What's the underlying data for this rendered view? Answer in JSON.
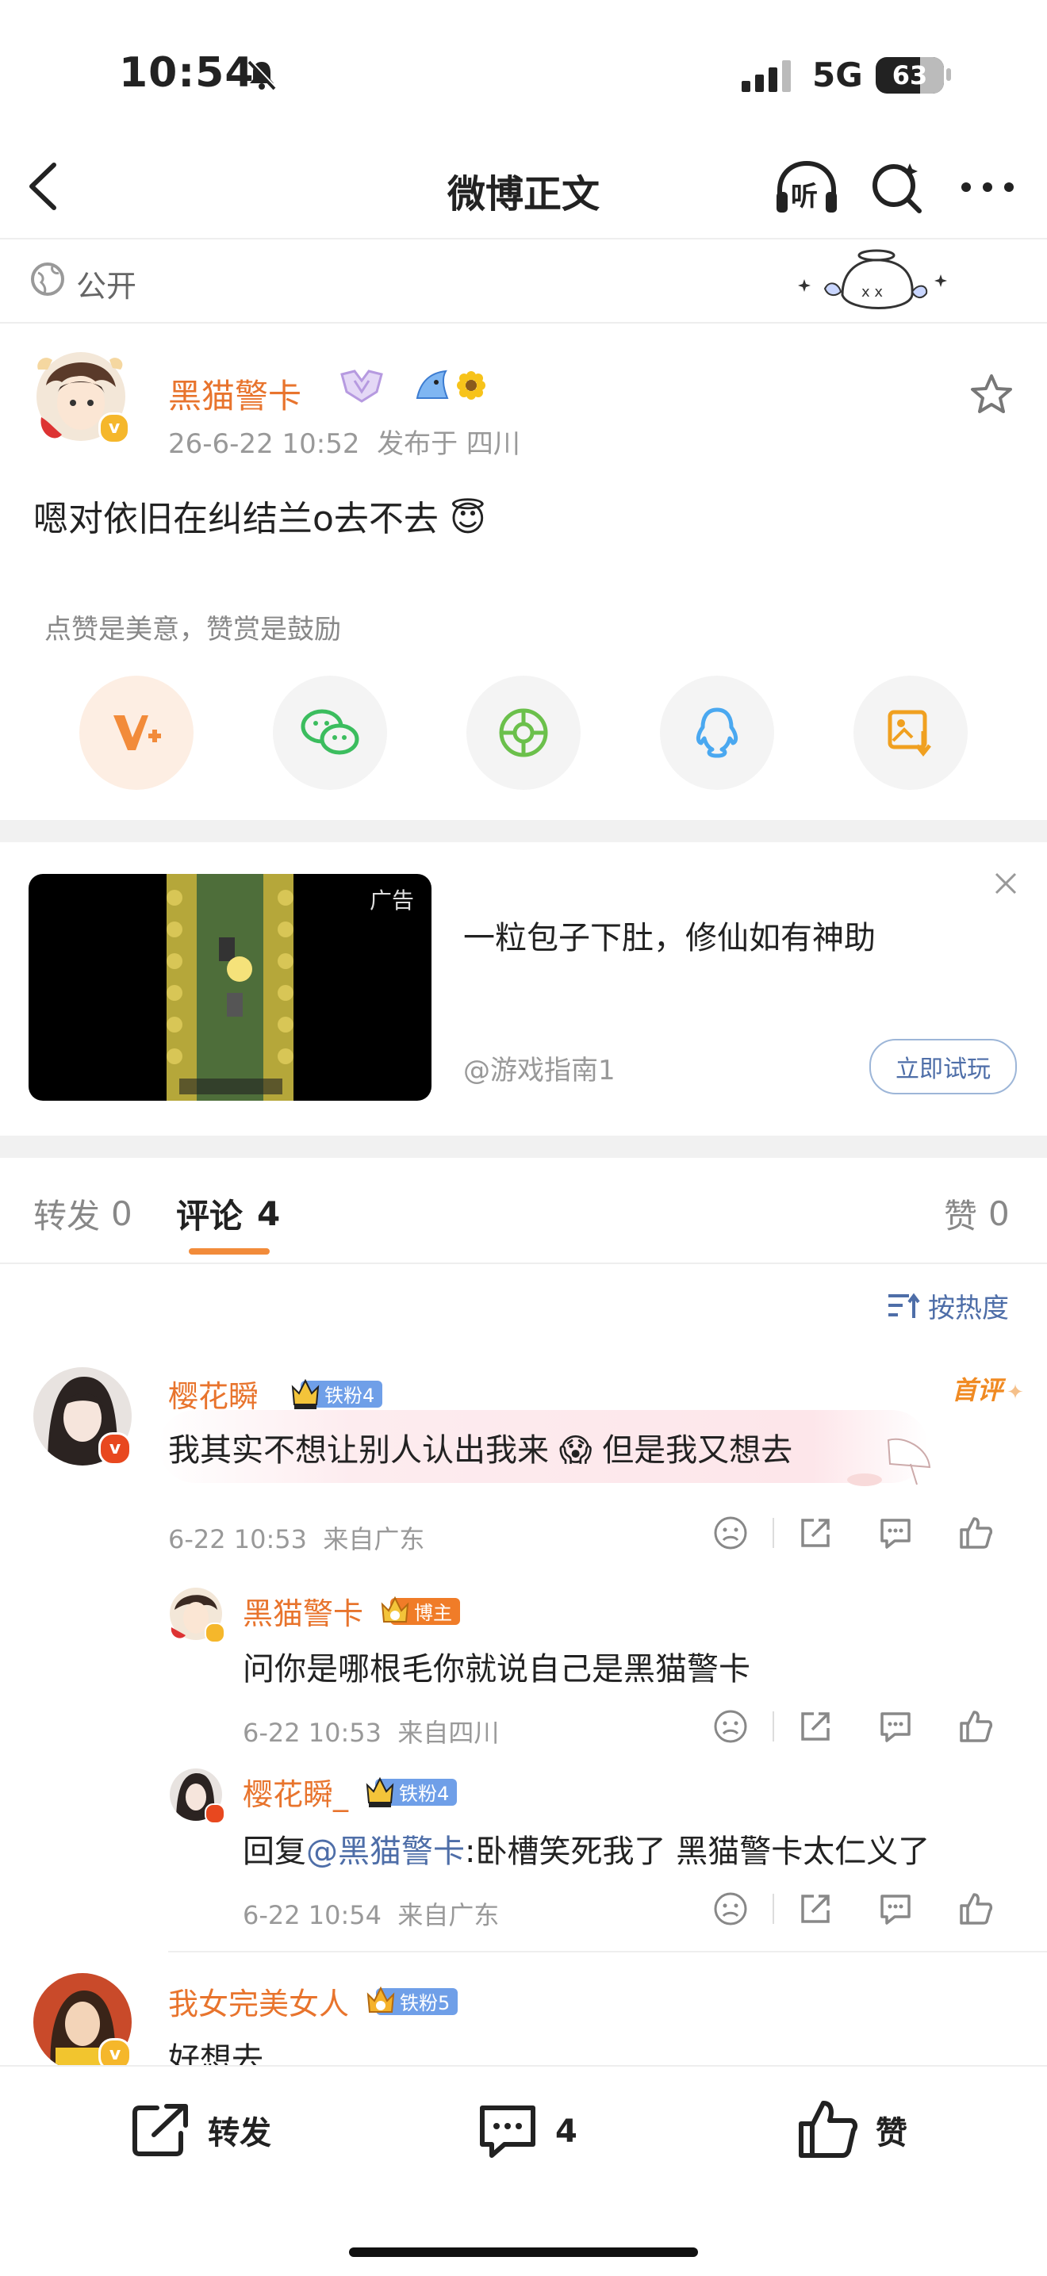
{
  "status_bar": {
    "time": "10:54",
    "network": "5G",
    "battery": "63"
  },
  "nav": {
    "title": "微博正文",
    "listen_label": "听"
  },
  "visibility": {
    "label": "公开"
  },
  "post": {
    "author": "黑猫警卡",
    "meta": "26-6-22 10:52  发布于 四川",
    "text": "嗯对依旧在纠结兰o去不去 😇",
    "tip_text": "点赞是美意，赞赏是鼓励"
  },
  "ad": {
    "tag": "广告",
    "title": "一粒包子下肚，修仙如有神助",
    "source": "@游戏指南1",
    "cta": "立即试玩"
  },
  "tabs": {
    "repost_label": "转发",
    "repost_count": "0",
    "comment_label": "评论",
    "comment_count": "4",
    "like_label": "赞",
    "like_count": "0"
  },
  "sort": {
    "label": "按热度"
  },
  "comments": [
    {
      "user": "樱花瞬_",
      "badge": "铁粉4",
      "first_tag": "首评",
      "text": "我其实不想让别人认出我来 😱 但是我又想去",
      "meta": "6-22 10:53  来自广东"
    }
  ],
  "replies": [
    {
      "user": "黑猫警卡",
      "badge": "博主",
      "text": "问你是哪根毛你就说自己是黑猫警卡",
      "meta": "6-22 10:53  来自四川"
    },
    {
      "user": "樱花瞬_",
      "badge": "铁粉4",
      "reply_prefix": "回复",
      "mention": "@黑猫警卡",
      "text": ":卧槽笑死我了 黑猫警卡太仁义了",
      "meta": "6-22 10:54  来自广东"
    }
  ],
  "comment2": {
    "user": "我女完美女人",
    "badge": "铁粉5",
    "text": "好想去"
  },
  "bottom": {
    "repost": "转发",
    "comment_count": "4",
    "like": "赞"
  },
  "colors": {
    "accent": "#e8742d",
    "link": "#4e6ea8",
    "badge_blue": "#6f9fe8"
  }
}
